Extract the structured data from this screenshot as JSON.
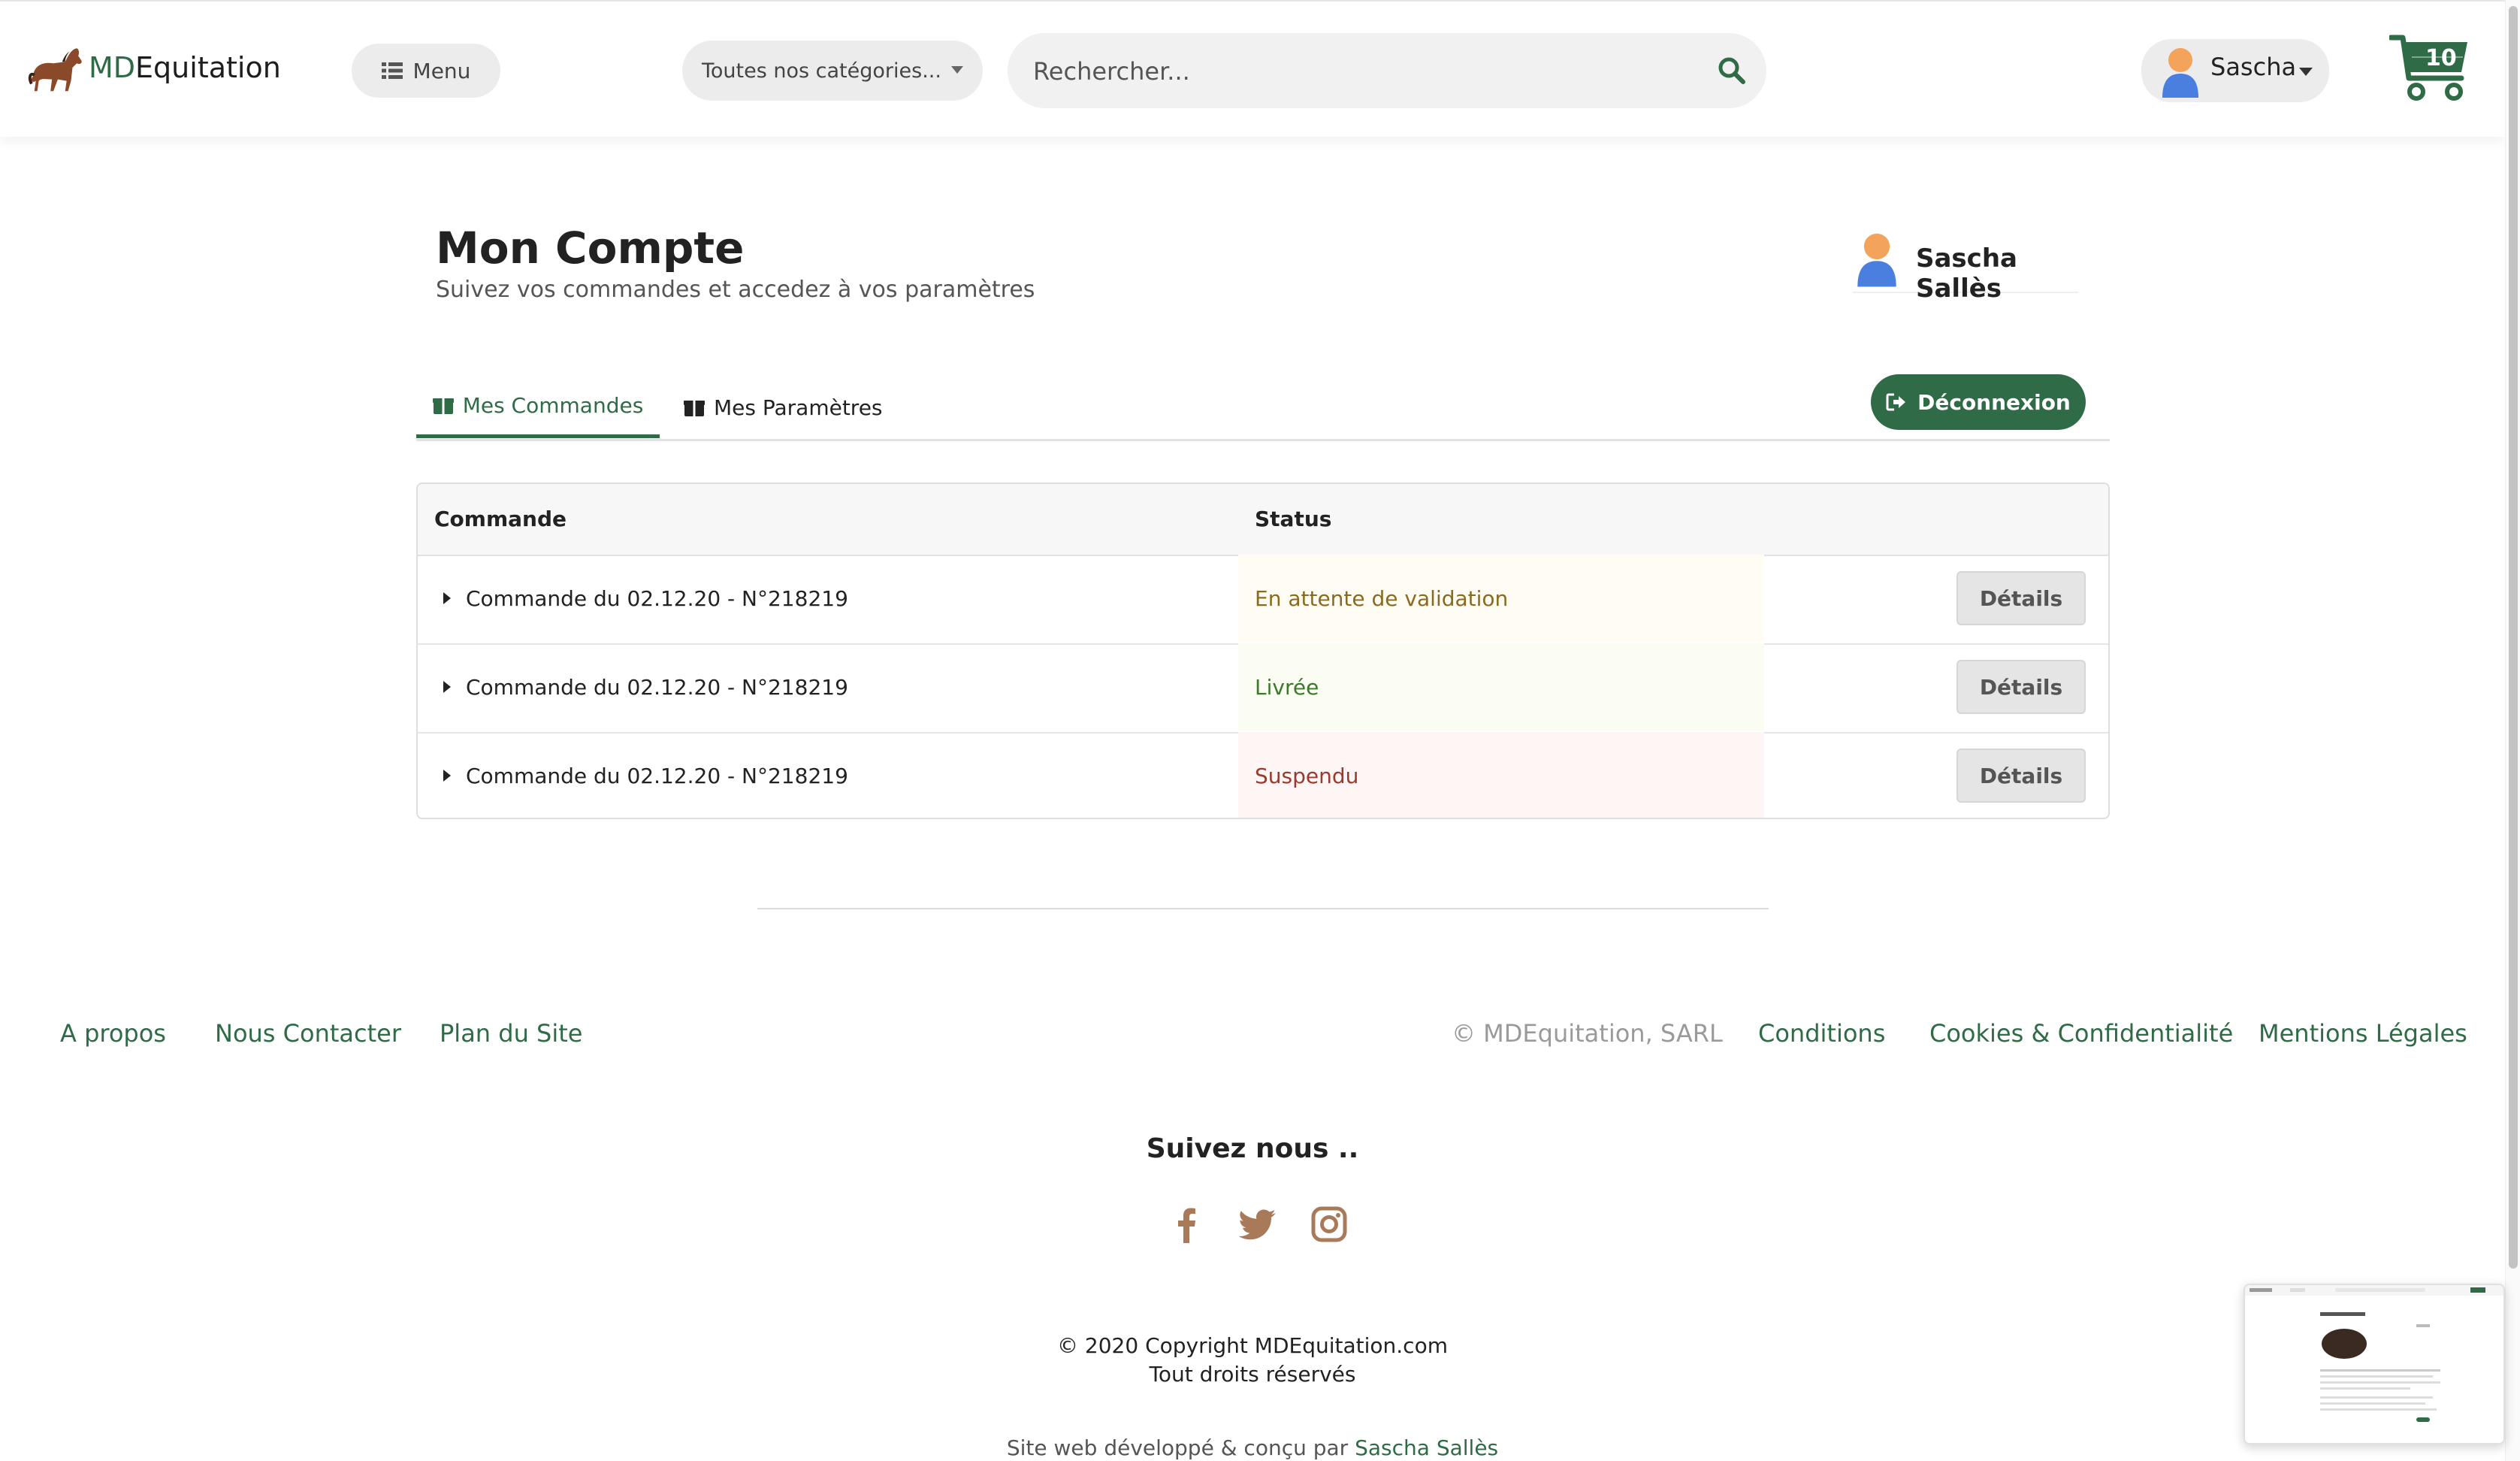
{
  "header": {
    "brand_prefix": "MD",
    "brand_suffix": "Equitation",
    "menu_label": "Menu",
    "category_select": "Toutes nos catégories...",
    "search_placeholder": "Rechercher...",
    "user_name": "Sascha",
    "cart_count": "10"
  },
  "account": {
    "title": "Mon Compte",
    "subtitle": "Suivez vos commandes et accedez à vos paramètres",
    "full_name": "Sascha Sallès"
  },
  "tabs": [
    {
      "label": "Mes Commandes",
      "active": true
    },
    {
      "label": "Mes Paramètres",
      "active": false
    }
  ],
  "logout_label": "Déconnexion",
  "orders": {
    "headers": {
      "order": "Commande",
      "status": "Status"
    },
    "rows": [
      {
        "order": "Commande du 02.12.20 - N°218219",
        "status": "En attente de validation",
        "details": "Détails",
        "status_color": "#8a6a1f",
        "status_bg": "#fffcf3"
      },
      {
        "order": "Commande du 02.12.20 - N°218219",
        "status": "Livrée",
        "details": "Détails",
        "status_color": "#3b7a2a",
        "status_bg": "#fbfdf2"
      },
      {
        "order": "Commande du 02.12.20 - N°218219",
        "status": "Suspendu",
        "details": "Détails",
        "status_color": "#9a3a2e",
        "status_bg": "#fdf6f5"
      }
    ]
  },
  "footer": {
    "left_links": [
      "A propos",
      "Nous Contacter",
      "Plan du Site"
    ],
    "company": "© MDEquitation, SARL",
    "right_links": [
      "Conditions",
      "Cookies & Confidentialité",
      "Mentions Légales"
    ],
    "follow_title": "Suivez nous ..",
    "social_icons": [
      "facebook-icon",
      "twitter-icon",
      "instagram-icon"
    ],
    "copyright_line1": "© 2020 Copyright MDEquitation.com",
    "copyright_line2": "Tout droits réservés",
    "credits_prefix": "Site web développé & conçu par",
    "credits_author": "Sascha Sallès"
  },
  "colors": {
    "brand_green": "#2f6b46",
    "social_brown": "#a87a5a"
  }
}
